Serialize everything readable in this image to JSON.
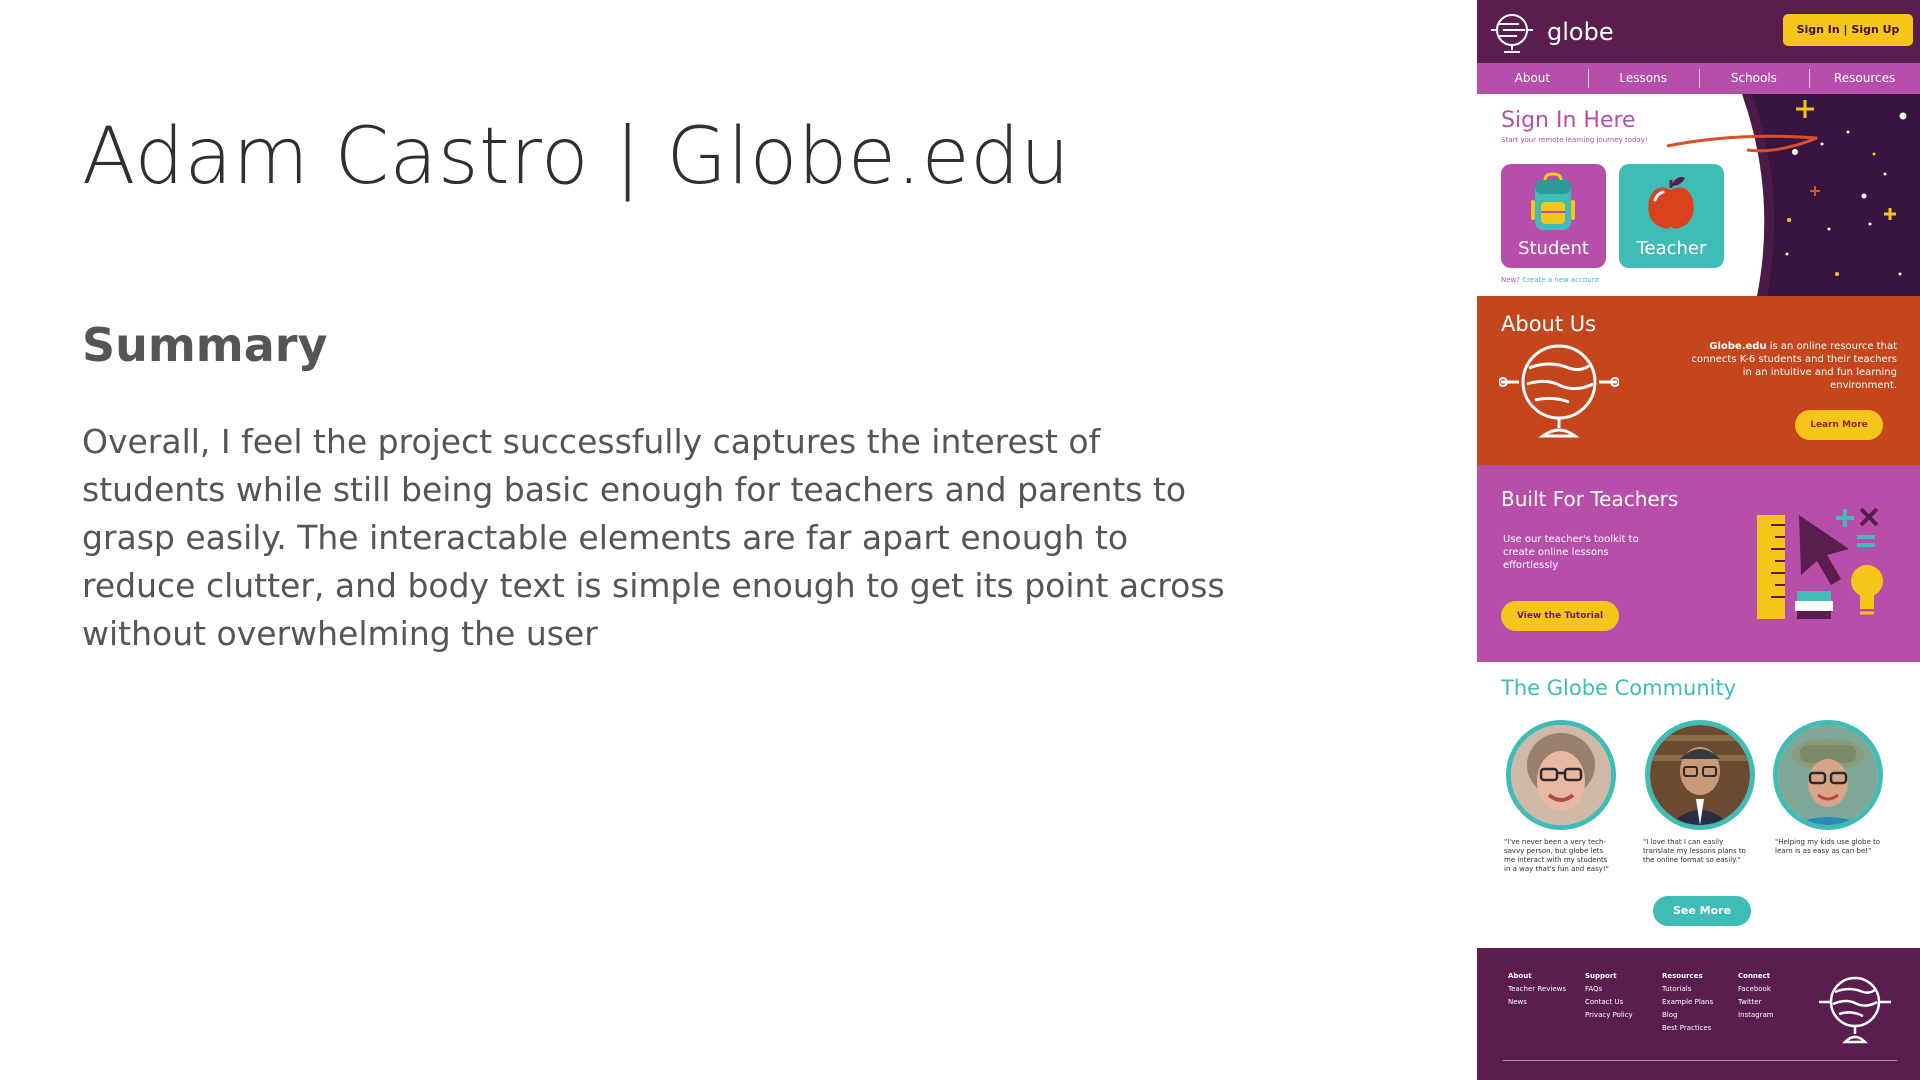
{
  "slide": {
    "title": "Adam Castro | Globe.edu",
    "heading": "Summary",
    "body": "Overall, I feel the project successfully captures the interest of students while still being basic enough for teachers and parents to grasp easily. The interactable elements are far apart enough to reduce clutter, and body text is simple enough to get its point across without overwhelming the user"
  },
  "mockup": {
    "header": {
      "logo_text": "globe",
      "signin_label": "Sign In | Sign Up"
    },
    "nav": [
      "About",
      "Lessons",
      "Schools",
      "Resources"
    ],
    "hero": {
      "title": "Sign In Here",
      "subtitle": "Start your remote learning journey today!",
      "student_label": "Student",
      "teacher_label": "Teacher",
      "new_q": "New?",
      "new_link": "Create a new account"
    },
    "about": {
      "title": "About Us",
      "brand": "Globe.edu",
      "text": " is an online resource that connects K-6 students and their teachers in an intuitive and fun learning environment.",
      "button": "Learn More"
    },
    "teachers": {
      "title": "Built For Teachers",
      "text": "Use our teacher's toolkit to create online lessons effortlessly",
      "button": "View the Tutorial"
    },
    "community": {
      "title": "The Globe Community",
      "quotes": [
        "\"I've never been a very tech-savvy person, but globe lets me interact with my students in a way that's fun and easy!\"",
        "\"I love that I can easily translate my lessons plans to the online format so easily.\"",
        "\"Helping my kids use globe to learn is as easy as can be!\""
      ],
      "button": "See More"
    },
    "footer": {
      "columns": [
        {
          "heading": "About",
          "links": [
            "Teacher Reviews",
            "News"
          ]
        },
        {
          "heading": "Support",
          "links": [
            "FAQs",
            "Contact Us",
            "Privacy Policy"
          ]
        },
        {
          "heading": "Resources",
          "links": [
            "Tutorials",
            "Example Plans",
            "Blog",
            "Best Practices"
          ]
        },
        {
          "heading": "Connect",
          "links": [
            "Facebook",
            "Twitter",
            "Instagram"
          ]
        }
      ]
    },
    "colors": {
      "purple_dark": "#5a1d4f",
      "magenta": "#b74eaa",
      "orange": "#c5461c",
      "teal": "#3fbcb5",
      "yellow": "#f6c519"
    }
  }
}
